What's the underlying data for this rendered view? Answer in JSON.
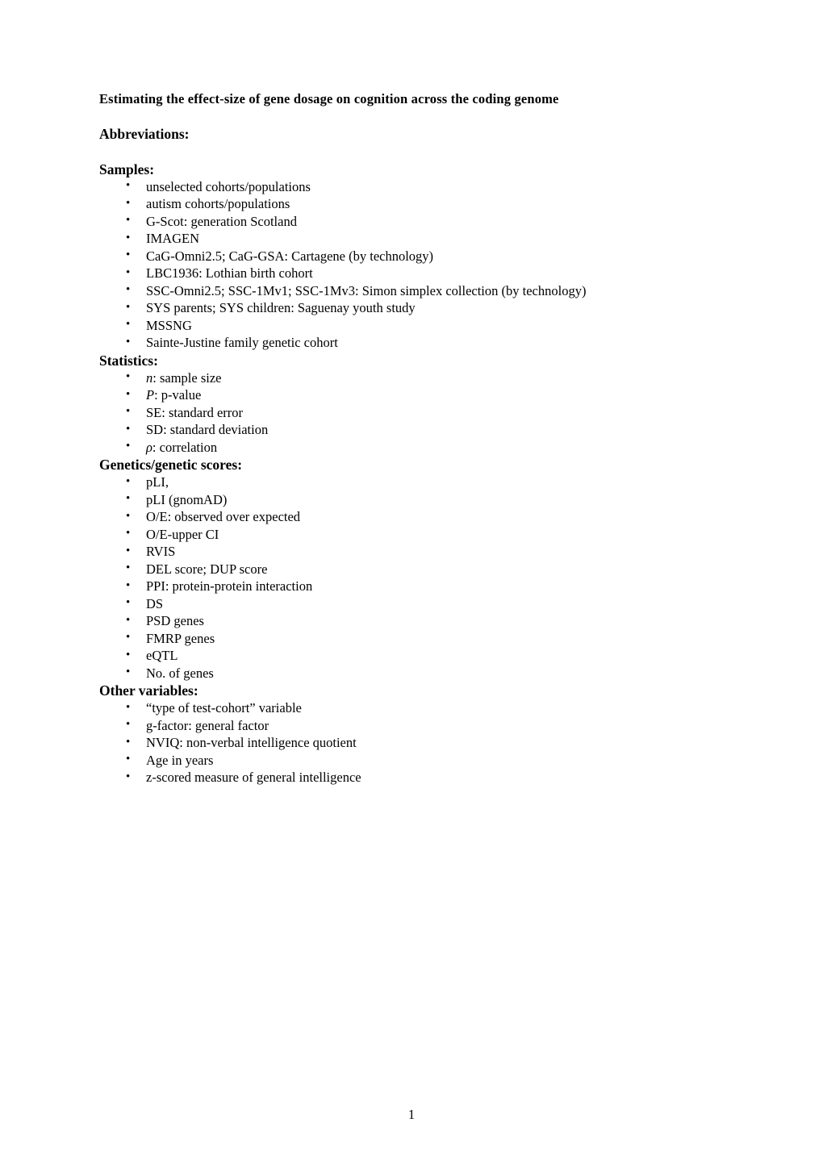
{
  "document": {
    "title": "Estimating the effect-size of gene dosage on cognition across the coding genome",
    "abbreviations_heading": "Abbreviations:",
    "page_number": "1"
  },
  "sections": [
    {
      "heading": "Samples:",
      "items": [
        "unselected cohorts/populations",
        "autism cohorts/populations",
        "G-Scot: generation Scotland",
        "IMAGEN",
        "CaG-Omni2.5; CaG-GSA: Cartagene (by technology)",
        "LBC1936: Lothian birth cohort",
        "SSC-Omni2.5; SSC-1Mv1; SSC-1Mv3: Simon simplex collection (by technology)",
        "SYS parents; SYS children: Saguenay youth study",
        "MSSNG",
        "Sainte-Justine family genetic cohort"
      ]
    },
    {
      "heading": "Statistics:",
      "items": [
        {
          "italic_prefix": "n",
          "rest": ": sample size"
        },
        {
          "italic_prefix": "P",
          "rest": ": p-value"
        },
        {
          "italic_prefix": "",
          "rest": "SE: standard error"
        },
        {
          "italic_prefix": "",
          "rest": "SD: standard deviation"
        },
        {
          "italic_prefix": "ρ",
          "rest": ": correlation"
        }
      ]
    },
    {
      "heading": "Genetics/genetic scores:",
      "items": [
        "pLI,",
        "pLI (gnomAD)",
        "O/E: observed over expected",
        "O/E-upper CI",
        "RVIS",
        "DEL score; DUP score",
        "PPI: protein-protein interaction",
        "DS",
        "PSD genes",
        "FMRP genes",
        "eQTL",
        "No. of genes"
      ]
    },
    {
      "heading": "Other variables:",
      "items": [
        "“type of test-cohort” variable",
        "g-factor: general factor",
        "NVIQ: non-verbal intelligence quotient",
        "Age in years",
        "z-scored measure of general intelligence"
      ]
    }
  ]
}
